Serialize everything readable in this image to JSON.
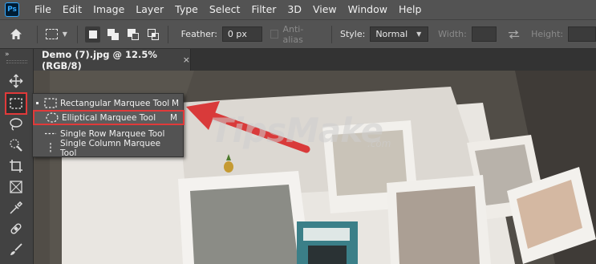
{
  "app": {
    "logo_text": "Ps",
    "menu": [
      "File",
      "Edit",
      "Image",
      "Layer",
      "Type",
      "Select",
      "Filter",
      "3D",
      "View",
      "Window",
      "Help"
    ]
  },
  "options": {
    "feather_label": "Feather:",
    "feather_value": "0 px",
    "antialias_label": "Anti-alias",
    "style_label": "Style:",
    "style_value": "Normal",
    "width_label": "Width:",
    "height_label": "Height:"
  },
  "document": {
    "tab_title": "Demo (7).jpg @ 12.5% (RGB/8)",
    "close_glyph": "×"
  },
  "toolbar": {
    "collapse_glyph": "»",
    "selected_tool": "rectangular-marquee"
  },
  "flyout": {
    "items": [
      {
        "label": "Rectangular Marquee Tool",
        "key": "M",
        "active": true
      },
      {
        "label": "Elliptical Marquee Tool",
        "key": "M",
        "highlighted": true
      },
      {
        "label": "Single Row Marquee Tool",
        "key": ""
      },
      {
        "label": "Single Column Marquee Tool",
        "key": ""
      }
    ]
  },
  "watermark": {
    "text": "TipsMake",
    "suffix": ".com"
  },
  "colors": {
    "menu_bg": "#535353",
    "panel_bg": "#424242",
    "highlight_red": "#e13a3a",
    "ps_blue": "#31a8ff"
  }
}
